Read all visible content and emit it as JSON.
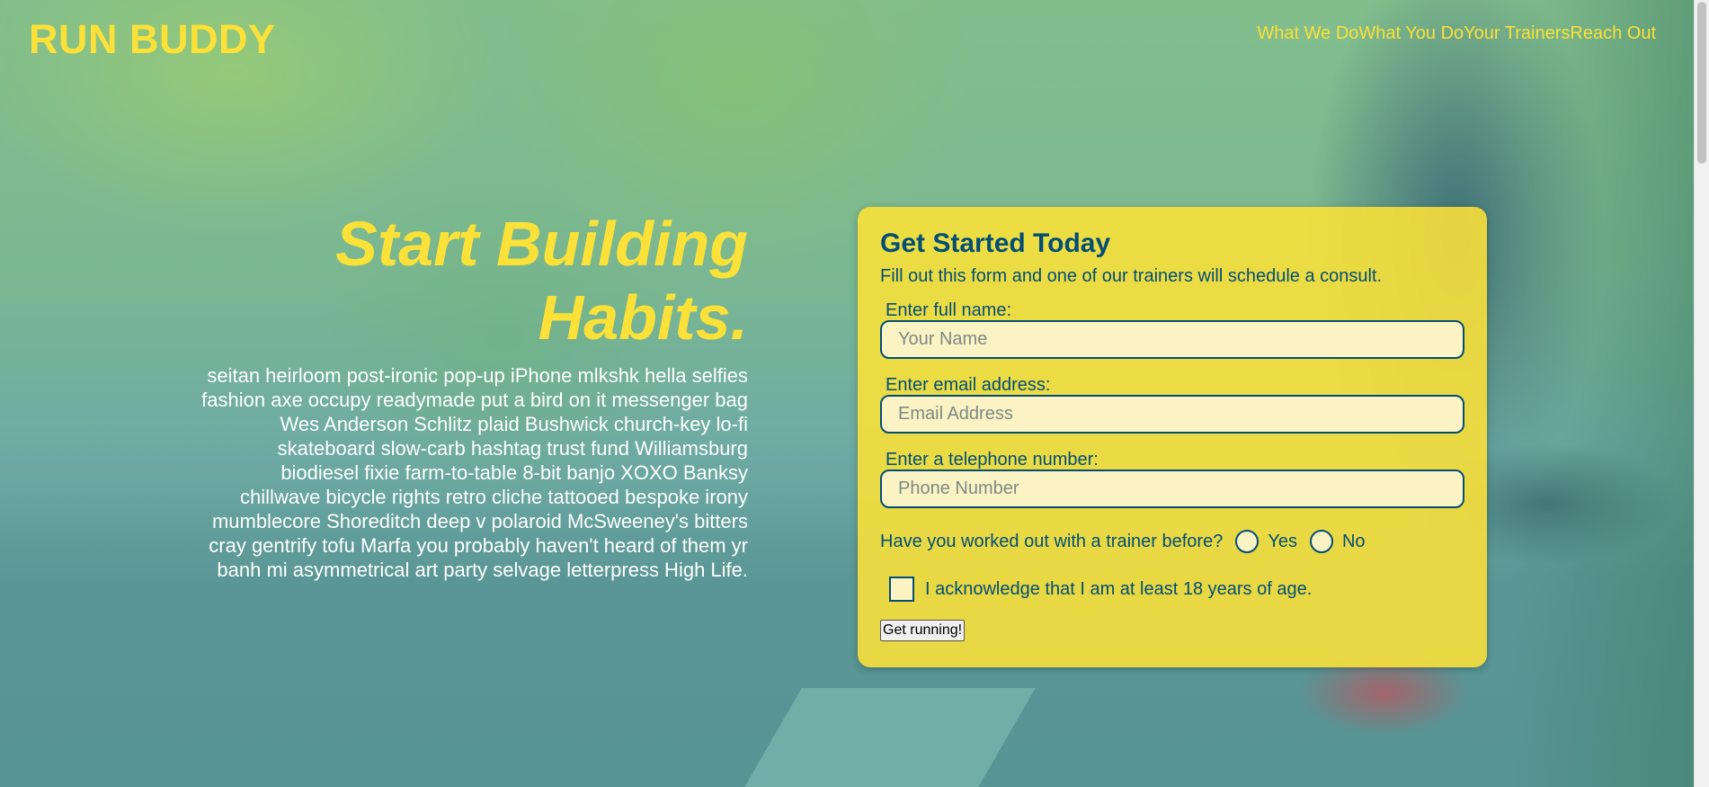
{
  "header": {
    "logo": "RUN BUDDY",
    "nav": [
      "What We Do",
      "What You Do",
      "Your Trainers",
      "Reach Out"
    ]
  },
  "hero": {
    "title_line1": "Start Building",
    "title_line2": "Habits.",
    "copy": "seitan heirloom post-ironic pop-up iPhone mlkshk hella selfies fashion axe occupy readymade put a bird on it messenger bag Wes Anderson Schlitz plaid Bushwick church-key lo-fi skateboard slow-carb hashtag trust fund Williamsburg biodiesel fixie farm-to-table 8-bit banjo XOXO Banksy chillwave bicycle rights retro cliche tattooed bespoke irony mumblecore Shoreditch deep v polaroid McSweeney's bitters cray gentrify tofu Marfa you probably haven't heard of them yr banh mi asymmetrical art party selvage letterpress High Life."
  },
  "form": {
    "title": "Get Started Today",
    "subtitle": "Fill out this form and one of our trainers will schedule a consult.",
    "name_label": "Enter full name:",
    "name_placeholder": "Your Name",
    "name_value": "",
    "email_label": "Enter email address:",
    "email_placeholder": "Email Address",
    "email_value": "",
    "phone_label": "Enter a telephone number:",
    "phone_placeholder": "Phone Number",
    "phone_value": "",
    "trainer_question": "Have you worked out with a trainer before?",
    "radio_yes": "Yes",
    "radio_no": "No",
    "radio_selected": "none",
    "age_ack": "I acknowledge that I am at least 18 years of age.",
    "age_checked": false,
    "submit_label": "Get running!"
  },
  "colors": {
    "brand_yellow": "#fce138",
    "brand_blue": "#024e76",
    "input_bg": "#fbf3c4"
  },
  "icons": {
    "scrollbar": "vertical-scrollbar"
  }
}
